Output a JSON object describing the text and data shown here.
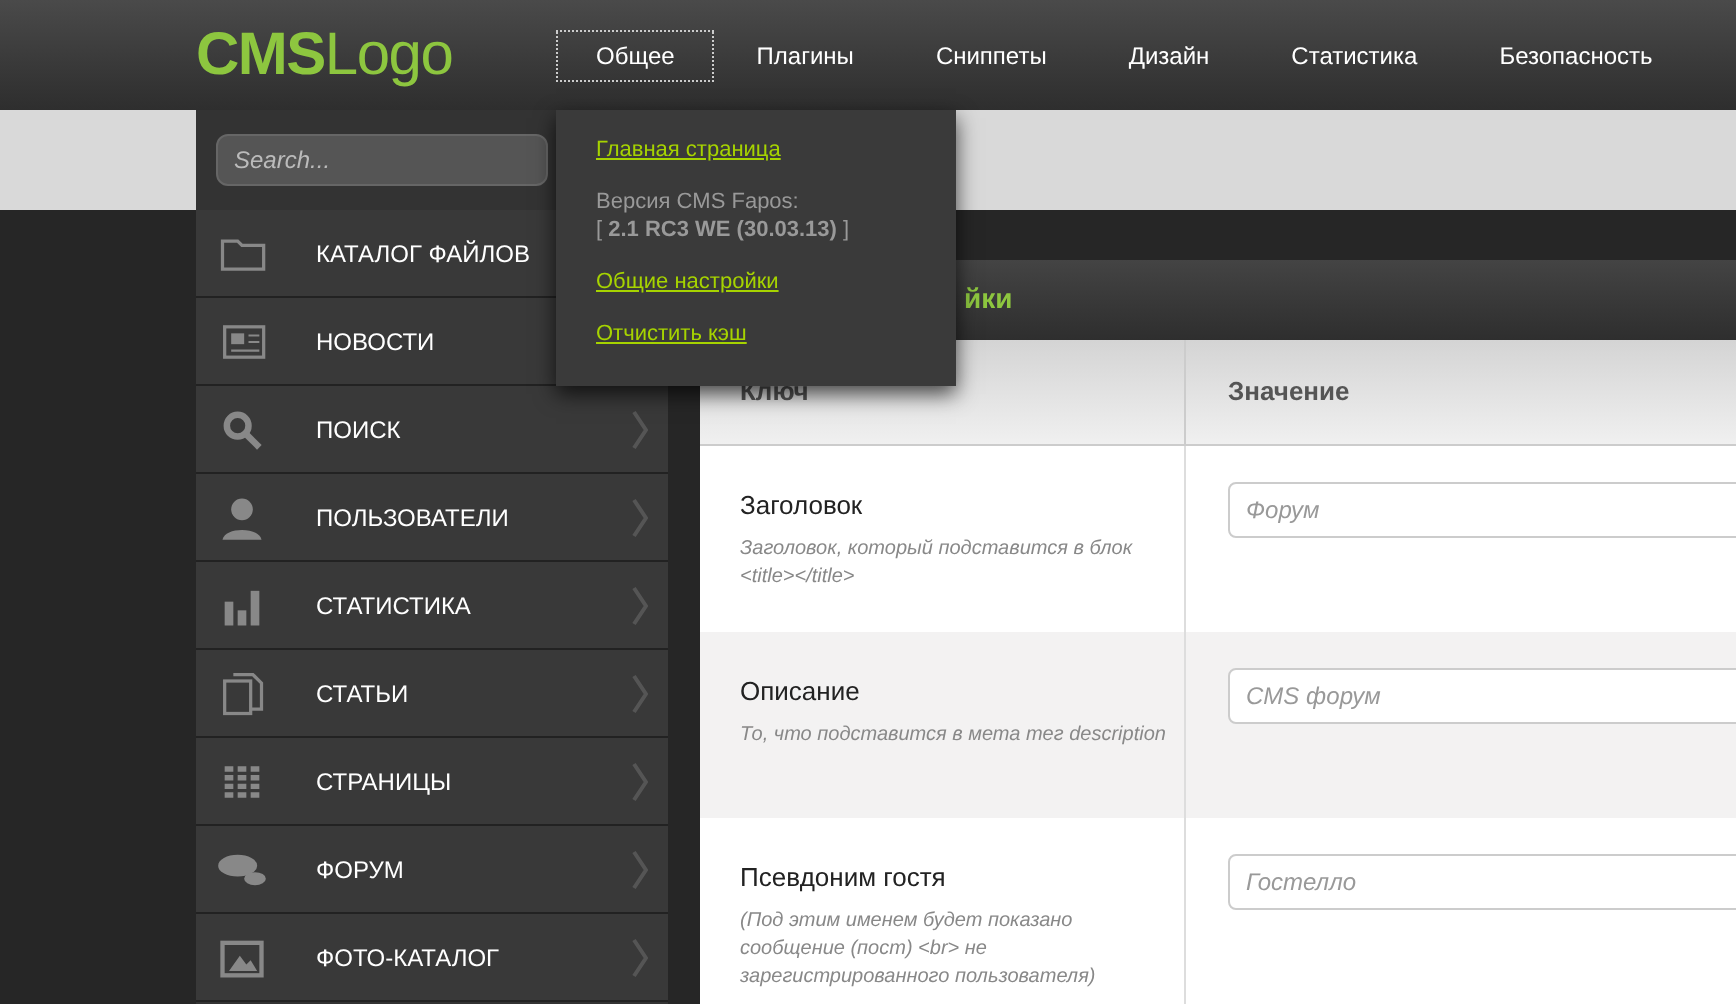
{
  "logo": {
    "part_1": "CMS",
    "part_2": "Logo"
  },
  "nav": [
    {
      "label": "Общее",
      "selected": true
    },
    {
      "label": "Плагины",
      "selected": false
    },
    {
      "label": "Сниппеты",
      "selected": false
    },
    {
      "label": "Дизайн",
      "selected": false
    },
    {
      "label": "Статистика",
      "selected": false
    },
    {
      "label": "Безопасность",
      "selected": false
    }
  ],
  "search": {
    "placeholder": "Search..."
  },
  "sidebar": {
    "items": [
      {
        "label": "КАТАЛОГ ФАЙЛОВ"
      },
      {
        "label": "НОВОСТИ"
      },
      {
        "label": "ПОИСК"
      },
      {
        "label": "ПОЛЬЗОВАТЕЛИ"
      },
      {
        "label": "СТАТИСТИКА"
      },
      {
        "label": "СТАТЬИ"
      },
      {
        "label": "СТРАНИЦЫ"
      },
      {
        "label": "ФОРУМ"
      },
      {
        "label": "ФОТО-КАТАЛОГ"
      }
    ]
  },
  "dropdown": {
    "items": [
      {
        "kind": "link",
        "text": "Главная страница"
      },
      {
        "kind": "info",
        "text": "Версия CMS Fapos:",
        "detail": "[ **2.1 RC3 WE (30.03.13)** ]"
      },
      {
        "kind": "link",
        "text": "Общие настройки"
      },
      {
        "kind": "link",
        "text": "Отчистить кэш"
      }
    ]
  },
  "panel": {
    "title": "йки"
  },
  "table": {
    "columns": [
      "Ключ",
      "Значение"
    ],
    "rows": [
      {
        "key": "Заголовок",
        "hint": "Заголовок, который подставится в блок <title></title>",
        "placeholder": "Форум"
      },
      {
        "key": "Описание",
        "hint": "То, что подставится в мета тег description",
        "placeholder": "CMS форум"
      },
      {
        "key": "Псевдоним гостя",
        "hint": "(Под этим именем будет показано сообщение (пост) <br> не зарегистрированного пользователя)",
        "placeholder": "Гостелло"
      }
    ]
  }
}
